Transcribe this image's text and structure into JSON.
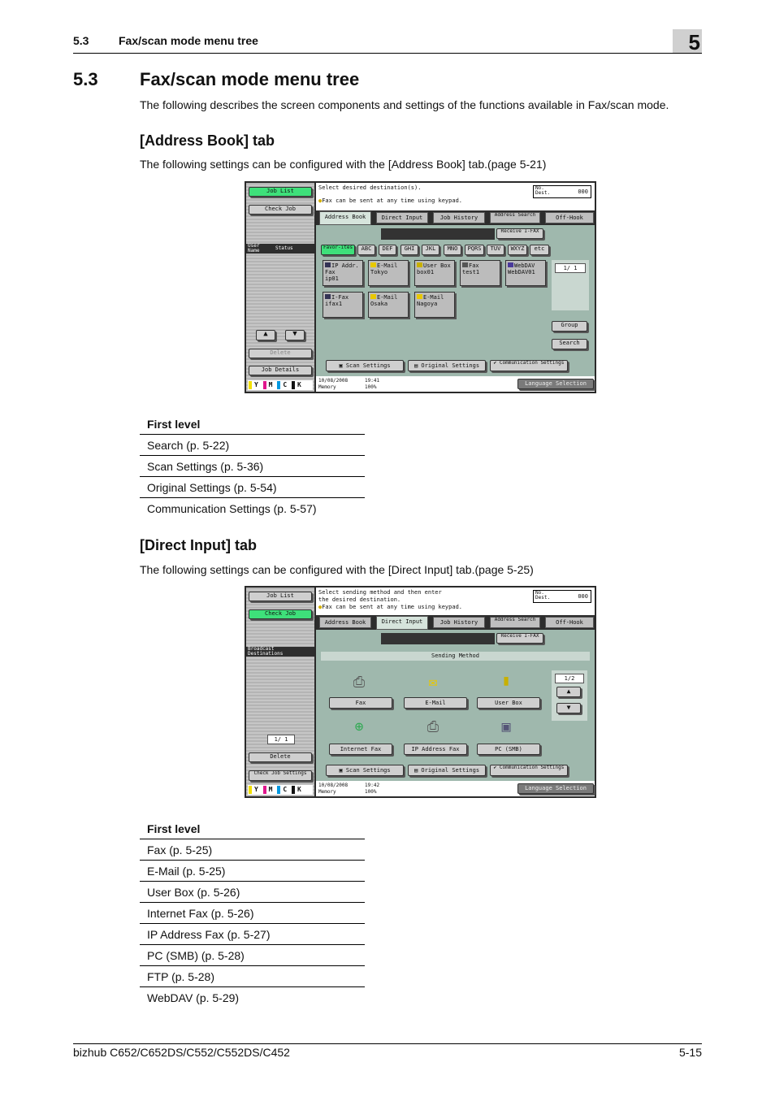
{
  "header": {
    "section_num": "5.3",
    "section_title": "Fax/scan mode menu tree",
    "chapter": "5"
  },
  "page_heading": {
    "num": "5.3",
    "title": "Fax/scan mode menu tree"
  },
  "intro": "The following describes the screen components and settings of the functions available in Fax/scan mode.",
  "address_book": {
    "heading": "[Address Book] tab",
    "desc": "The following settings can be configured with the [Address Book] tab.(page 5-21)",
    "table_header": "First level",
    "rows": [
      "Search (p. 5-22)",
      "Scan Settings (p. 5-36)",
      "Original Settings (p. 5-54)",
      "Communication Settings (p. 5-57)"
    ]
  },
  "direct_input": {
    "heading": "[Direct Input] tab",
    "desc": "The following settings can be configured with the [Direct Input] tab.(page 5-25)",
    "table_header": "First level",
    "rows": [
      "Fax (p. 5-25)",
      "E-Mail (p. 5-25)",
      "User Box (p. 5-26)",
      "Internet Fax (p. 5-26)",
      "IP Address Fax (p. 5-27)",
      "PC (SMB) (p. 5-28)",
      "FTP (p. 5-28)",
      "WebDAV (p. 5-29)"
    ]
  },
  "panel1": {
    "left": {
      "job_list": "Job List",
      "check_job": "Check Job",
      "user_name": "User Name",
      "status": "Status",
      "delete": "Delete",
      "job_details": "Job Details"
    },
    "msg1": "Select desired destination(s).",
    "msg2": "Fax can be sent at any time using keypad.",
    "counter_label": "No. Dest.",
    "counter_value": "000",
    "tabs": [
      "Address Book",
      "Direct Input",
      "Job History",
      "Address Search",
      "Off-Hook"
    ],
    "receive": "Receive I-FAX",
    "index": [
      "Favor-ites",
      "ABC",
      "DEF",
      "GHI",
      "JKL",
      "MNO",
      "PQRS",
      "TUV",
      "WXYZ",
      "etc"
    ],
    "dests": [
      {
        "type": "IP Addr. Fax",
        "name": "ip01"
      },
      {
        "type": "E-Mail",
        "name": "Tokyo"
      },
      {
        "type": "User Box",
        "name": "box01"
      },
      {
        "type": "Fax",
        "name": "test1"
      },
      {
        "type": "WebDAV",
        "name": "WebDAV01"
      },
      {
        "type": "I-Fax",
        "name": "ifax1"
      },
      {
        "type": "E-Mail",
        "name": "Osaka"
      },
      {
        "type": "E-Mail",
        "name": "Nagoya"
      }
    ],
    "page": "1/ 1",
    "group": "Group",
    "search": "Search",
    "scan_settings": "Scan Settings",
    "original_settings": "Original Settings",
    "communication_settings": "Communication Settings",
    "date": "10/08/2008",
    "time": "19:41",
    "memory": "Memory",
    "memory_pct": "100%",
    "language": "Language Selection"
  },
  "panel2": {
    "left": {
      "job_list": "Job List",
      "check_job": "Check Job",
      "broadcast": "Broadcast Destinations",
      "page": "1/ 1",
      "delete": "Delete",
      "check_job_settings": "Check Job Settings"
    },
    "msg1": "Select sending method and then enter",
    "msg1b": "the desired destination.",
    "msg2": "Fax can be sent at any time using keypad.",
    "counter_label": "No. Dest.",
    "counter_value": "000",
    "tabs": [
      "Address Book",
      "Direct Input",
      "Job History",
      "Address Search",
      "Off-Hook"
    ],
    "receive": "Receive I-FAX",
    "sending_method": "Sending Method",
    "methods": [
      "Fax",
      "E-Mail",
      "User Box",
      "Internet Fax",
      "IP Address Fax",
      "PC (SMB)"
    ],
    "page": "1/2",
    "scan_settings": "Scan Settings",
    "original_settings": "Original Settings",
    "communication_settings": "Communication Settings",
    "date": "10/08/2008",
    "time": "19:42",
    "memory": "Memory",
    "memory_pct": "100%",
    "language": "Language Selection"
  },
  "ink": [
    "Y",
    "M",
    "C",
    "K"
  ],
  "ink_colors": {
    "Y": "#f2e000",
    "M": "#e0168c",
    "C": "#0098e0",
    "K": "#111111"
  },
  "footer": {
    "model": "bizhub C652/C652DS/C552/C552DS/C452",
    "page": "5-15"
  }
}
